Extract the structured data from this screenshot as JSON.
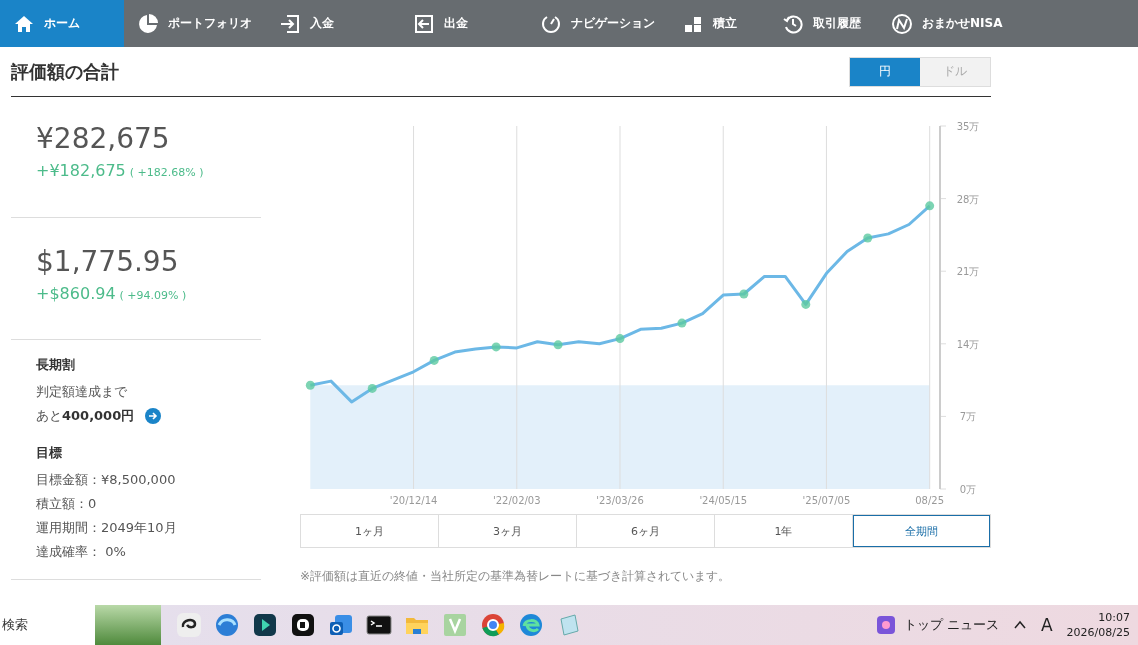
{
  "nav": {
    "items": [
      {
        "label": "ホーム",
        "selected": true
      },
      {
        "label": "ポートフォリオ",
        "selected": false
      },
      {
        "label": "入金",
        "selected": false
      },
      {
        "label": "出金",
        "selected": false
      },
      {
        "label": "ナビゲーション",
        "selected": false
      },
      {
        "label": "積立",
        "selected": false
      },
      {
        "label": "取引履歴",
        "selected": false
      },
      {
        "label": "おまかせNISA",
        "selected": false
      }
    ]
  },
  "header": {
    "title": "評価額の合計",
    "currency": [
      {
        "label": "円",
        "selected": true
      },
      {
        "label": "ドル",
        "selected": false
      }
    ]
  },
  "summary": {
    "amounts": [
      {
        "value": "¥282,675",
        "change": "+¥182,675",
        "percent": "( +182.68% )"
      },
      {
        "value": "$1,775.95",
        "change": "+$860.94",
        "percent": "( +94.09% )"
      }
    ],
    "discount": {
      "title": "長期割",
      "line": "判定額達成まで",
      "remaining": "あと**400,000円**"
    },
    "goal": {
      "title": "目標",
      "lines": [
        "目標金額：¥8,500,000",
        "積立額：0",
        "運用期間：2049年10月",
        "達成確率： 0%"
      ]
    }
  },
  "chart": {
    "chart_data": {
      "type": "line",
      "categories": [
        null,
        null,
        null,
        null,
        null,
        "'20/12/14",
        null,
        null,
        null,
        null,
        "'22/02/03",
        null,
        null,
        null,
        null,
        "'23/03/26",
        null,
        null,
        null,
        null,
        "'24/05/15",
        null,
        null,
        null,
        null,
        "'25/07/05",
        null,
        null,
        null,
        null,
        "08/25"
      ],
      "series": [
        {
          "type": "line",
          "color": "#6cb8e6",
          "values": [
            10,
            10.4,
            8.4,
            9.7,
            10.5,
            11.3,
            12.4,
            13.2,
            13.5,
            13.7,
            13.6,
            14.2,
            13.9,
            14.2,
            14,
            14.5,
            15.4,
            15.5,
            16,
            16.9,
            18.7,
            18.8,
            20.5,
            20.5,
            17.8,
            20.8,
            22.9,
            24.2,
            24.6,
            25.5,
            27.3
          ]
        },
        {
          "type": "area",
          "color": "#e3f0fa",
          "values": [
            10,
            10,
            10,
            10,
            10,
            10,
            10,
            10,
            10,
            10,
            10,
            10,
            10,
            10,
            10,
            10,
            10,
            10,
            10,
            10,
            10,
            10,
            10,
            10,
            10,
            10,
            10,
            10,
            10,
            10,
            10
          ]
        }
      ],
      "yticks": [
        {
          "value": 0,
          "label": "0万"
        },
        {
          "value": 7,
          "label": "7万"
        },
        {
          "value": 14,
          "label": "14万"
        },
        {
          "value": 21,
          "label": "21万"
        },
        {
          "value": 28,
          "label": "28万"
        },
        {
          "value": 35,
          "label": "35万"
        }
      ],
      "ylim": [
        0,
        35
      ],
      "grid": true
    },
    "periods": [
      {
        "label": "1ヶ月",
        "selected": false
      },
      {
        "label": "3ヶ月",
        "selected": false
      },
      {
        "label": "6ヶ月",
        "selected": false
      },
      {
        "label": "1年",
        "selected": false
      },
      {
        "label": "全期間",
        "selected": true
      }
    ],
    "note": "※評価額は直近の終値・当社所定の基準為替レートに基づき計算されています。"
  },
  "taskbar": {
    "search": "検索",
    "news": "トップ ニュース",
    "ime": "A",
    "time": "10:07",
    "date": "2026/08/25"
  }
}
